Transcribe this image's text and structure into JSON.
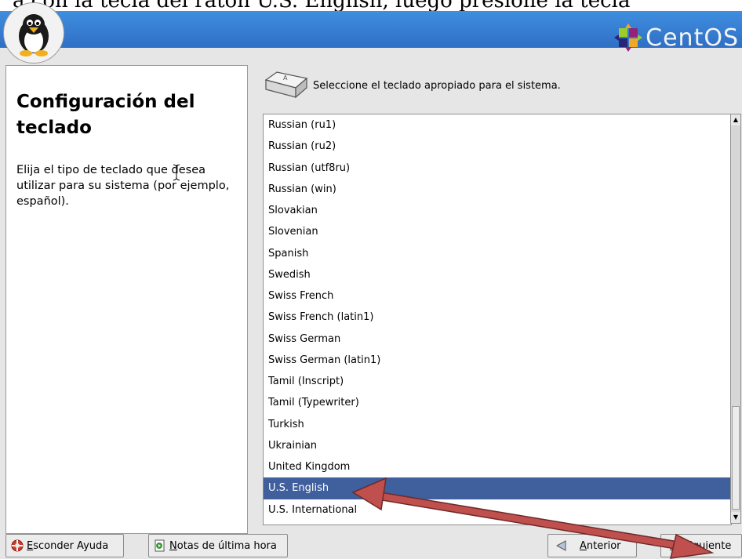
{
  "top_caption": "a con la tecla del ratón  U.S. English, luego presione la tecla",
  "banner": {
    "brand": "CentOS"
  },
  "help": {
    "title_part1": "Configuración",
    "title_part2": " del",
    "title_part3": "teclado",
    "description": "Elija el tipo de teclado que desea utilizar para su sistema (por ejemplo, español)."
  },
  "keyboard_prompt": "Seleccione el teclado apropiado para el sistema.",
  "keyboard_list": {
    "items": [
      "Russian (ru1)",
      "Russian (ru2)",
      "Russian (utf8ru)",
      "Russian (win)",
      "Slovakian",
      "Slovenian",
      "Spanish",
      "Swedish",
      "Swiss French",
      "Swiss French (latin1)",
      "Swiss German",
      "Swiss German (latin1)",
      "Tamil (Inscript)",
      "Tamil (Typewriter)",
      "Turkish",
      "Ukrainian",
      "United Kingdom",
      "U.S. English",
      "U.S. International"
    ],
    "selected": "U.S. English"
  },
  "buttons": {
    "hide_help_key": "E",
    "hide_help_rest": "sconder Ayuda",
    "release_notes_key": "N",
    "release_notes_rest": "otas de última hora",
    "back_key": "A",
    "back_rest": "nterior",
    "next_key": "S",
    "next_rest": "iguiente"
  },
  "colors": {
    "banner": "#3a82d8",
    "selection": "#3f5f9d",
    "annotation_arrow": "#c0504d"
  },
  "icons": [
    "penguin-logo-icon",
    "centos-logo-icon",
    "keyboard-key-icon",
    "lifebuoy-icon",
    "release-notes-icon",
    "left-triangle-icon",
    "right-triangle-icon"
  ]
}
